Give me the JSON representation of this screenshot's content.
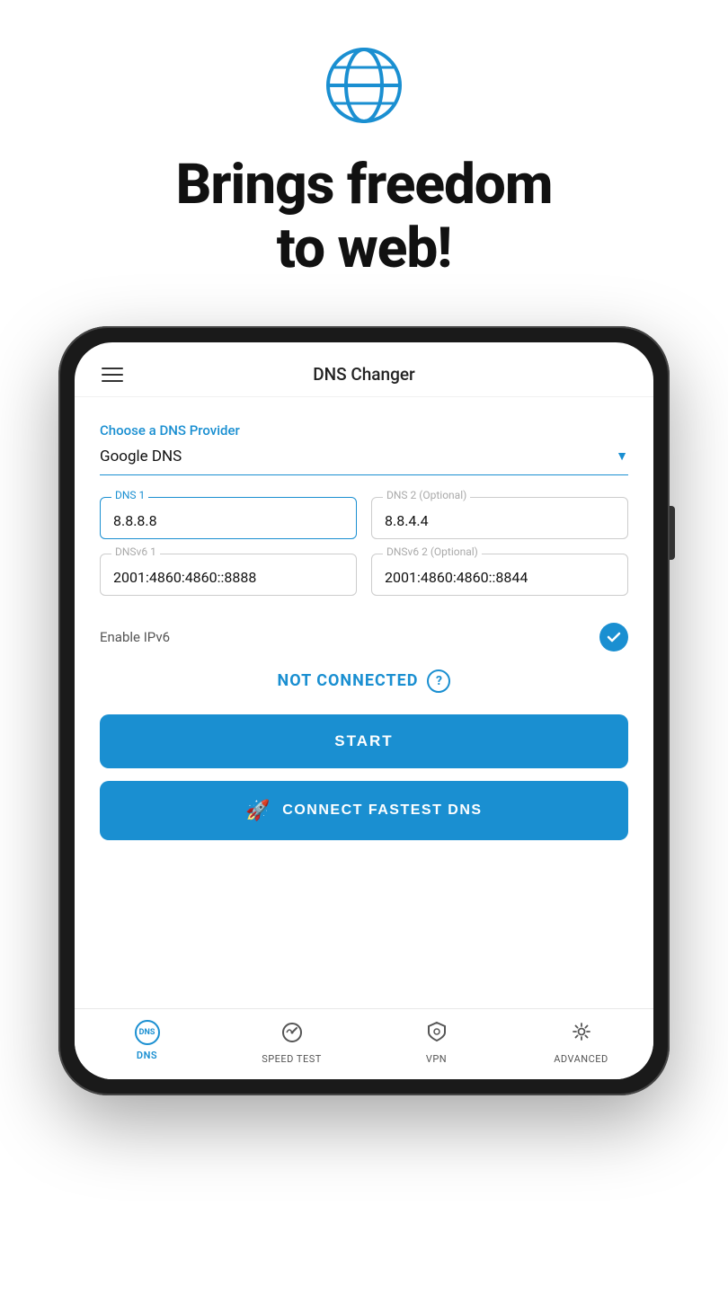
{
  "top": {
    "headline_line1": "Brings freedom",
    "headline_line2": "to web!"
  },
  "app": {
    "title": "DNS Changer",
    "hamburger_label": "menu",
    "dns_provider_section": {
      "label": "Choose a DNS Provider",
      "selected_value": "Google DNS"
    },
    "dns1": {
      "label": "DNS 1",
      "value": "8.8.8.8"
    },
    "dns2": {
      "label": "DNS 2 (Optional)",
      "value": "8.8.4.4"
    },
    "dnsv6_1": {
      "label": "DNSv6 1",
      "value": "2001:4860:4860::8888"
    },
    "dnsv6_2": {
      "label": "DNSv6 2 (Optional)",
      "value": "2001:4860:4860::8844"
    },
    "ipv6": {
      "label": "Enable IPv6",
      "enabled": true
    },
    "status": {
      "text": "NOT CONNECTED"
    },
    "start_button": "START",
    "connect_button": "CONNECT FASTEST DNS"
  },
  "bottom_nav": {
    "items": [
      {
        "id": "dns",
        "label": "DNS",
        "active": true
      },
      {
        "id": "speed-test",
        "label": "SPEED TEST",
        "active": false
      },
      {
        "id": "vpn",
        "label": "VPN",
        "active": false
      },
      {
        "id": "advanced",
        "label": "ADVANCED",
        "active": false
      }
    ]
  },
  "colors": {
    "accent": "#1a8fd1",
    "text_dark": "#111111",
    "text_mid": "#555555",
    "bg": "#ffffff"
  }
}
